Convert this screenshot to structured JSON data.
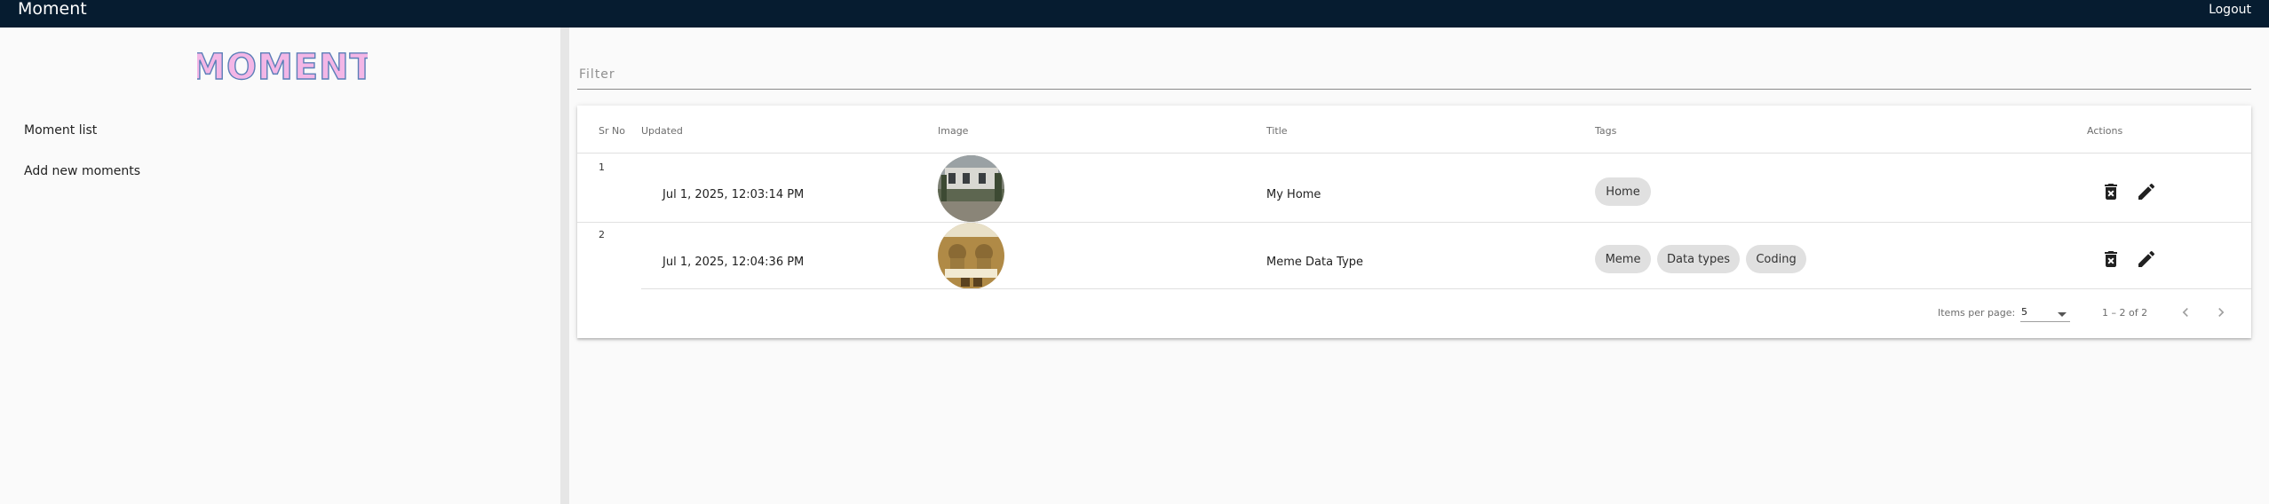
{
  "app": {
    "title": "Moment",
    "logout_label": "Logout",
    "logo_text": "MOMENT"
  },
  "sidebar": {
    "items": [
      {
        "label": "Moment list"
      },
      {
        "label": "Add new moments"
      }
    ]
  },
  "filter": {
    "placeholder": "Filter",
    "value": ""
  },
  "table": {
    "headers": {
      "srno": "Sr No",
      "updated": "Updated",
      "image": "Image",
      "title": "Title",
      "tags": "Tags",
      "actions": "Actions"
    },
    "rows": [
      {
        "srno": "1",
        "updated": "Jul 1, 2025, 12:03:14 PM",
        "title": "My Home",
        "tags": [
          "Home"
        ]
      },
      {
        "srno": "2",
        "updated": "Jul 1, 2025, 12:04:36 PM",
        "title": "Meme Data Type",
        "tags": [
          "Meme",
          "Data types",
          "Coding"
        ]
      }
    ]
  },
  "paginator": {
    "items_per_page_label": "Items per page:",
    "page_size": "5",
    "range_label": "1 – 2 of 2"
  },
  "colors": {
    "topbar": "#061c30",
    "chip": "#e0e0e0",
    "logo_fill": "#f3b6e6",
    "logo_stroke": "#5b7fb8"
  }
}
